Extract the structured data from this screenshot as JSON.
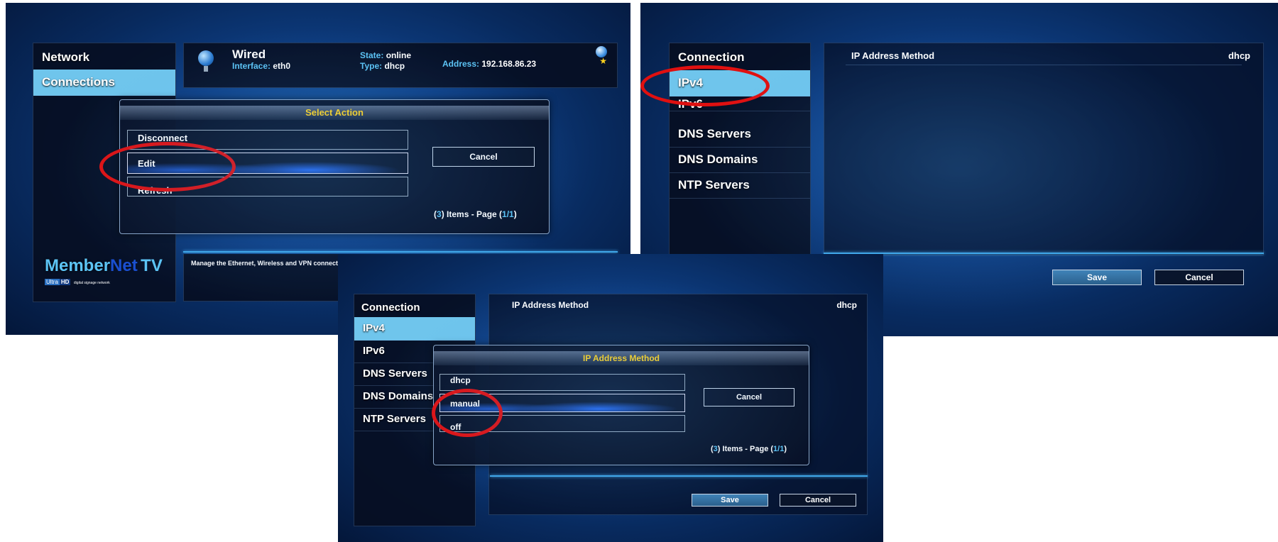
{
  "shot1": {
    "sidebar": {
      "title": "Network",
      "selected_item": "Connections"
    },
    "header": {
      "connection_name": "Wired",
      "interface_label": "Interface:",
      "interface_value": "eth0",
      "state_label": "State:",
      "state_value": "online",
      "type_label": "Type:",
      "type_value": "dhcp",
      "address_label": "Address:",
      "address_value": "192.168.86.23"
    },
    "dialog": {
      "title": "Select Action",
      "options": [
        "Disconnect",
        "Edit",
        "Refresh"
      ],
      "selected_option": "Edit",
      "cancel_label": "Cancel",
      "footer_count": "3",
      "footer_mid": ") Items - Page (",
      "footer_page": "1/1",
      "footer_open": "(",
      "footer_close": ")"
    },
    "status_text": "Manage the Ethernet, Wireless and VPN connections",
    "logo": {
      "member": "Member",
      "net": "Net",
      "tv": "TV",
      "ultra": "Ultra",
      "hd": "HD",
      "tagline": "digital signage network"
    }
  },
  "shot2": {
    "sidebar": {
      "title": "Connection",
      "items": [
        "IPv4",
        "IPv6",
        "DNS Servers",
        "DNS Domains",
        "NTP Servers"
      ],
      "selected": "IPv4"
    },
    "row": {
      "label": "IP Address Method",
      "value": "dhcp"
    },
    "save_label": "Save",
    "cancel_label": "Cancel"
  },
  "shot3": {
    "sidebar": {
      "title": "Connection",
      "items": [
        "IPv4",
        "IPv6",
        "DNS Servers",
        "DNS Domains",
        "NTP Servers"
      ],
      "selected": "IPv4"
    },
    "row": {
      "label": "IP Address Method",
      "value": "dhcp"
    },
    "dialog": {
      "title": "IP Address Method",
      "options": [
        "dhcp",
        "manual",
        "off"
      ],
      "selected_option": "manual",
      "cancel_label": "Cancel",
      "footer_count": "3",
      "footer_mid": ") Items - Page (",
      "footer_page": "1/1",
      "footer_open": "(",
      "footer_close": ")"
    },
    "save_label": "Save",
    "cancel_label": "Cancel"
  },
  "colors": {
    "accent": "#6fc5ec",
    "dialog_title": "#ffd21e",
    "highlight_ring": "#e01010"
  }
}
